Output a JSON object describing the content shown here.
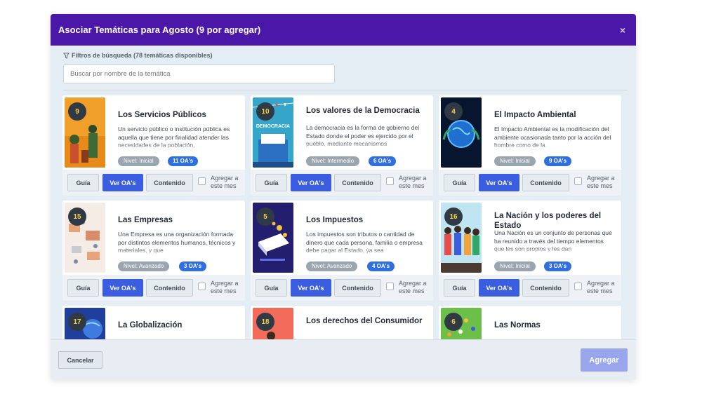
{
  "modal": {
    "title": "Asociar Temáticas para Agosto (9 por agregar)",
    "close_label": "×"
  },
  "filters": {
    "label": "Filtros de búsqueda (78 temáticas disponibles)",
    "search_placeholder": "Buscar por nombre de la temática"
  },
  "card_actions": {
    "guia": "Guía",
    "ver_oas": "Ver OA's",
    "contenido": "Contenido",
    "add_month": "Agregar a este mes"
  },
  "cards": [
    {
      "num": "9",
      "title": "Los Servicios Públicos",
      "desc": "Un servicio público o institución pública es aquella que tiene por finalidad atender las necesidades de la población,",
      "level": "Nivel: Inicial",
      "oas": "11 OA's"
    },
    {
      "num": "10",
      "title": "Los valores de la Democracia",
      "desc": "La democracia es la forma de gobierno del Estado donde el poder es ejercido por el pueblo, mediante mecanismos",
      "level": "Nivel: Intermedio",
      "oas": "6 OA's",
      "thumb_text": "DEMOCRACIA"
    },
    {
      "num": "4",
      "title": "El Impacto Ambiental",
      "desc": "El Impacto Ambiental es la modificación del ambiente ocasionada tanto por la acción del hombre como de la",
      "level": "Nivel: Inicial",
      "oas": "9 OA's"
    },
    {
      "num": "15",
      "title": "Las Empresas",
      "desc": "Una Empresa es una organización formada por distintos elementos humanos, técnicos y materiales, y que",
      "level": "Nivel: Avanzado",
      "oas": "3 OA's"
    },
    {
      "num": "5",
      "title": "Los Impuestos",
      "desc": "Los impuestos son tributos o cantidad de dinero que cada persona, familia o empresa debe pagar al Estado, ya sea",
      "level": "Nivel: Avanzado",
      "oas": "4 OA's"
    },
    {
      "num": "16",
      "title": "La Nación y los poderes del Estado",
      "desc": "Una Nación es un conjunto de personas que ha reunido a través del tiempo elementos que les son propios y les dan",
      "level": "Nivel: Inicial",
      "oas": "3 OA's"
    },
    {
      "num": "17",
      "title": "La Globalización"
    },
    {
      "num": "18",
      "title": "Los derechos del Consumidor"
    },
    {
      "num": "6",
      "title": "Las Normas"
    }
  ],
  "footer": {
    "cancel": "Cancelar",
    "add": "Agregar"
  },
  "colors": {
    "header": "#4a17a8",
    "primary_button": "#3b5ee0",
    "oa_badge": "#2f6fe0",
    "level_badge": "#9aa5b0",
    "number_badge_text": "#ffce45"
  }
}
